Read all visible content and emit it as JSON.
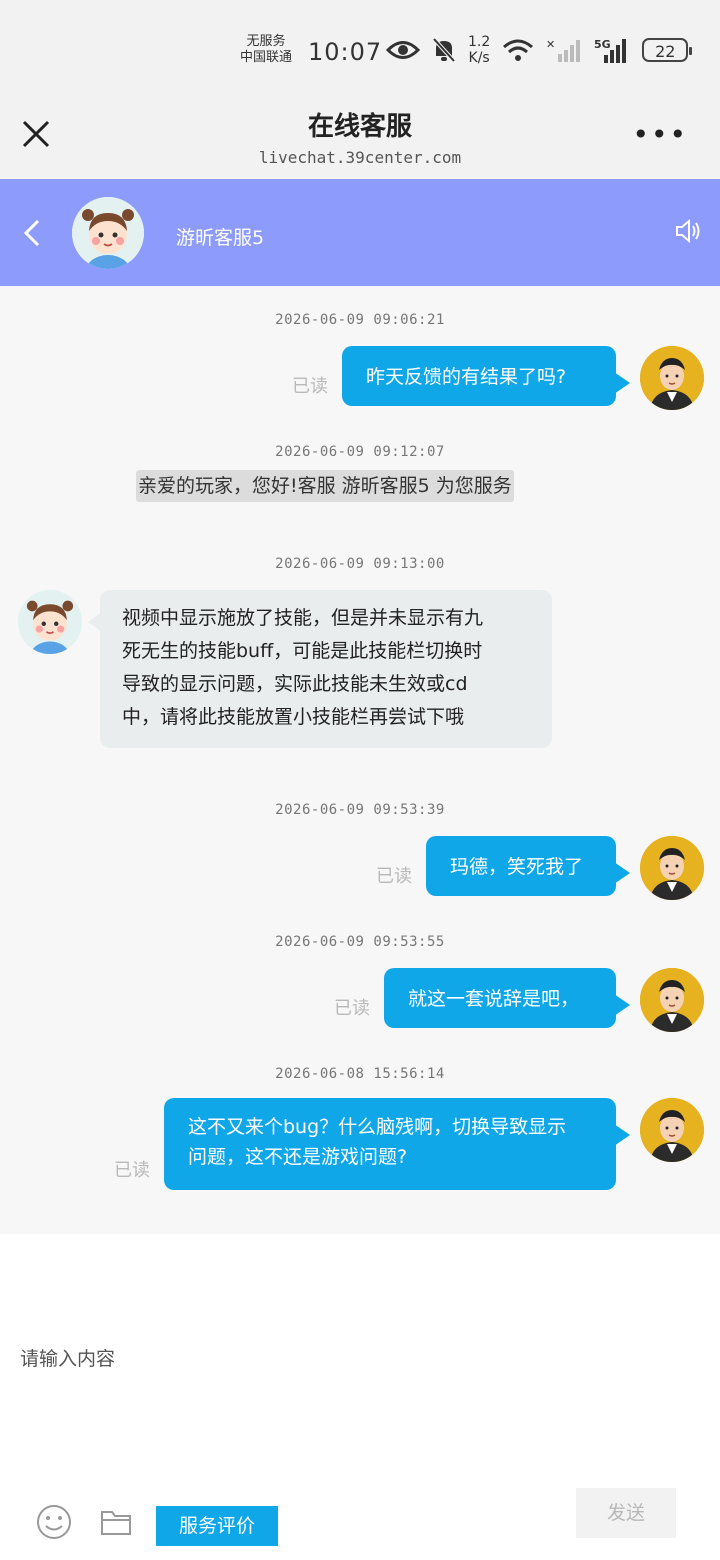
{
  "status_bar": {
    "carrier_line1": "无服务",
    "carrier_line2": "中国联通",
    "time": "10:07",
    "speed_value": "1.2",
    "speed_unit": "K/s",
    "network": "5G",
    "battery": "22"
  },
  "browser": {
    "title": "在线客服",
    "url": "livechat.39center.com"
  },
  "chat_header": {
    "agent_name": "游昕客服5"
  },
  "messages": {
    "m1": {
      "time": "2026-06-09 09:06:21",
      "text": "昨天反馈的有结果了吗?",
      "read": "已读"
    },
    "m2": {
      "time": "2026-06-09 09:12:07",
      "text": "亲爱的玩家，您好!客服 游昕客服5 为您服务"
    },
    "m3": {
      "time": "2026-06-09 09:13:00",
      "lines": [
        "视频中显示施放了技能，但是并未显示有九",
        "死无生的技能buff，可能是此技能栏切换时",
        "导致的显示问题，实际此技能未生效或cd",
        "中，请将此技能放置小技能栏再尝试下哦"
      ]
    },
    "m4": {
      "time": "2026-06-09 09:53:39",
      "text": "玛德，笑死我了",
      "read": "已读"
    },
    "m5": {
      "time": "2026-06-09 09:53:55",
      "text": "就这一套说辞是吧，",
      "read": "已读"
    },
    "m6": {
      "time": "2026-06-08 15:56:14",
      "lines": [
        "这不又来个bug？什么脑残啊，切换导致显示",
        "问题，这不还是游戏问题?"
      ],
      "read": "已读"
    }
  },
  "input": {
    "placeholder": "请输入内容",
    "rate_label": "服务评价",
    "send_label": "发送"
  },
  "icons": {
    "close": "close-icon",
    "more": "more-icon",
    "back": "back-icon",
    "sound": "speaker-icon",
    "emoji": "smiley-icon",
    "folder": "folder-icon"
  },
  "colors": {
    "header": "#8c9bfc",
    "bubble": "#10a7e9",
    "agent_bubble": "#e9edee"
  }
}
